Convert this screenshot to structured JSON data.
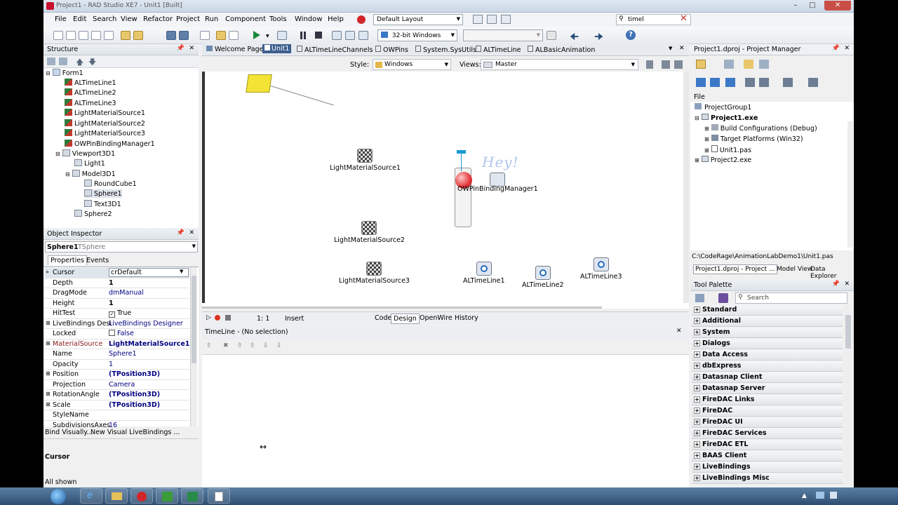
{
  "window": {
    "title": "Project1 - RAD Studio XE7 - Unit1 [Built]"
  },
  "menu": {
    "items": [
      "File",
      "Edit",
      "Search",
      "View",
      "Refactor",
      "Project",
      "Run",
      "Component",
      "Tools",
      "Window",
      "Help"
    ],
    "layout": "Default Layout",
    "search_value": "timel"
  },
  "toolbar": {
    "platform": "32-bit Windows"
  },
  "structure": {
    "title": "Structure",
    "items": [
      "Form1",
      "ALTimeLine1",
      "ALTimeLine2",
      "ALTimeLine3",
      "LightMaterialSource1",
      "LightMaterialSource2",
      "LightMaterialSource3",
      "OWPinBindingManager1",
      "Viewport3D1",
      "Light1",
      "Model3D1",
      "RoundCube1",
      "Sphere1",
      "Text3D1",
      "Sphere2"
    ]
  },
  "inspector": {
    "title": "Object Inspector",
    "object_name": "Sphere1",
    "object_type": "TSphere",
    "tabs": [
      "Properties",
      "Events"
    ],
    "rows": [
      {
        "name": "Cursor",
        "value": "crDefault"
      },
      {
        "name": "Depth",
        "value": "1"
      },
      {
        "name": "DragMode",
        "value": "dmManual"
      },
      {
        "name": "Height",
        "value": "1"
      },
      {
        "name": "HitTest",
        "value": "True"
      },
      {
        "name": "LiveBindings Desi",
        "value": "LiveBindings Designer"
      },
      {
        "name": "Locked",
        "value": "False"
      },
      {
        "name": "MaterialSource",
        "value": "LightMaterialSource1"
      },
      {
        "name": "Name",
        "value": "Sphere1"
      },
      {
        "name": "Opacity",
        "value": "1"
      },
      {
        "name": "Position",
        "value": "(TPosition3D)"
      },
      {
        "name": "Projection",
        "value": "Camera"
      },
      {
        "name": "RotationAngle",
        "value": "(TPosition3D)"
      },
      {
        "name": "Scale",
        "value": "(TPosition3D)"
      },
      {
        "name": "StyleName",
        "value": ""
      },
      {
        "name": "SubdivisionsAxes",
        "value": "16"
      }
    ],
    "bind_visually": "Bind Visually...",
    "new_binding": "New Visual LiveBindings ...",
    "desc_title": "Cursor",
    "footer": "All shown"
  },
  "editor": {
    "tabs": [
      "Welcome Page",
      "Unit1",
      "ALTimeLineChannels",
      "OWPins",
      "System.SysUtils",
      "ALTimeLine",
      "ALBasicAnimation"
    ],
    "style_label": "Style:",
    "style_value": "Windows",
    "views_label": "Views:",
    "views_value": "Master",
    "status_pos": "1: 1",
    "status_mode": "Insert",
    "bottom_tabs": [
      "Code",
      "Design",
      "OpenWire",
      "History"
    ]
  },
  "designer": {
    "components": [
      {
        "label": "LightMaterialSource1"
      },
      {
        "label": "LightMaterialSource2"
      },
      {
        "label": "LightMaterialSource3"
      },
      {
        "label": "OWPinBindingManager1"
      },
      {
        "label": "ALTimeLine1"
      },
      {
        "label": "ALTimeLine2"
      },
      {
        "label": "ALTimeLine3"
      }
    ],
    "hey_text": "Hey!"
  },
  "timeline": {
    "title": "TimeLine - (No selection)"
  },
  "project_manager": {
    "title": "Project1.dproj - Project Manager",
    "file_label": "File",
    "items": [
      "ProjectGroup1",
      "Project1.exe",
      "Build Configurations (Debug)",
      "Target Platforms (Win32)",
      "Unit1.pas",
      "Project2.exe"
    ],
    "path": "C:\\CodeRage\\AnimationLabDemo1\\Unit1.pas",
    "tabs": [
      "Project1.dproj - Project ...",
      "Model View",
      "Data Explorer"
    ]
  },
  "palette": {
    "title": "Tool Palette",
    "search_placeholder": "Search",
    "categories": [
      "Standard",
      "Additional",
      "System",
      "Dialogs",
      "Data Access",
      "dbExpress",
      "Datasnap Client",
      "Datasnap Server",
      "FireDAC Links",
      "FireDAC",
      "FireDAC UI",
      "FireDAC Services",
      "FireDAC ETL",
      "BAAS Client",
      "LiveBindings",
      "LiveBindings Misc"
    ]
  },
  "colors": {
    "accent": "#3c78c8",
    "selected": "#c6dcf4",
    "designer_bg": "#ffffff"
  }
}
